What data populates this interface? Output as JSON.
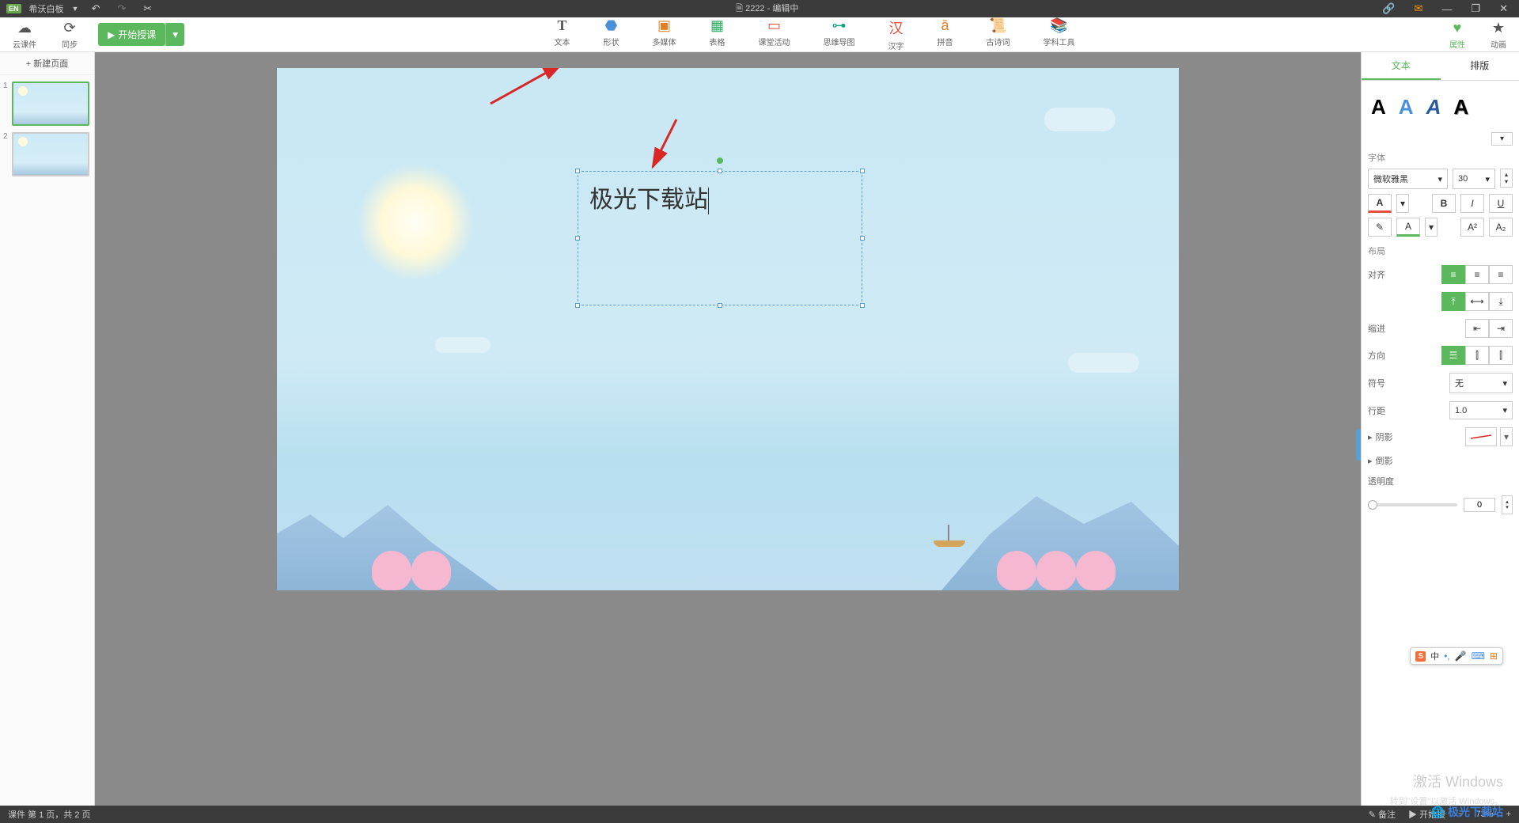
{
  "titlebar": {
    "app_badge": "EN",
    "app_name": "希沃白板",
    "doc_title": "2222 - 编辑中"
  },
  "toolbar": {
    "cloud": "云课件",
    "sync": "同步",
    "start_class": "开始授课",
    "center": {
      "text": "文本",
      "shape": "形状",
      "multimedia": "多媒体",
      "table": "表格",
      "activity": "课堂活动",
      "mindmap": "思维导图",
      "hanzi": "汉字",
      "pinyin": "拼音",
      "poem": "古诗词",
      "subject": "学科工具"
    },
    "right": {
      "properties": "属性",
      "animation": "动画"
    }
  },
  "slidepanel": {
    "new_page": "+ 新建页面",
    "s1": "1",
    "s2": "2"
  },
  "canvas": {
    "textbox_content": "极光下载站"
  },
  "rightpanel": {
    "tab_text": "文本",
    "tab_layout": "排版",
    "font_section": "字体",
    "font_name": "微软雅黑",
    "font_size": "30",
    "layout_section": "布局",
    "align_label": "对齐",
    "indent_label": "缩进",
    "direction_label": "方向",
    "symbol_label": "符号",
    "symbol_value": "无",
    "linespace_label": "行距",
    "linespace_value": "1.0",
    "shadow_label": "阴影",
    "reflection_label": "倒影",
    "opacity_label": "透明度",
    "opacity_value": "0"
  },
  "statusbar": {
    "page_info": "课件 第 1 页，共 2 页",
    "note": "备注",
    "start": "开始授",
    "zoom": "73%"
  },
  "ime": {
    "logo": "S",
    "lang": "中"
  },
  "watermark": {
    "line1": "激活 Windows",
    "line2": "转到\"设置\"以激活 Windows。"
  },
  "branding": "极光下载站"
}
